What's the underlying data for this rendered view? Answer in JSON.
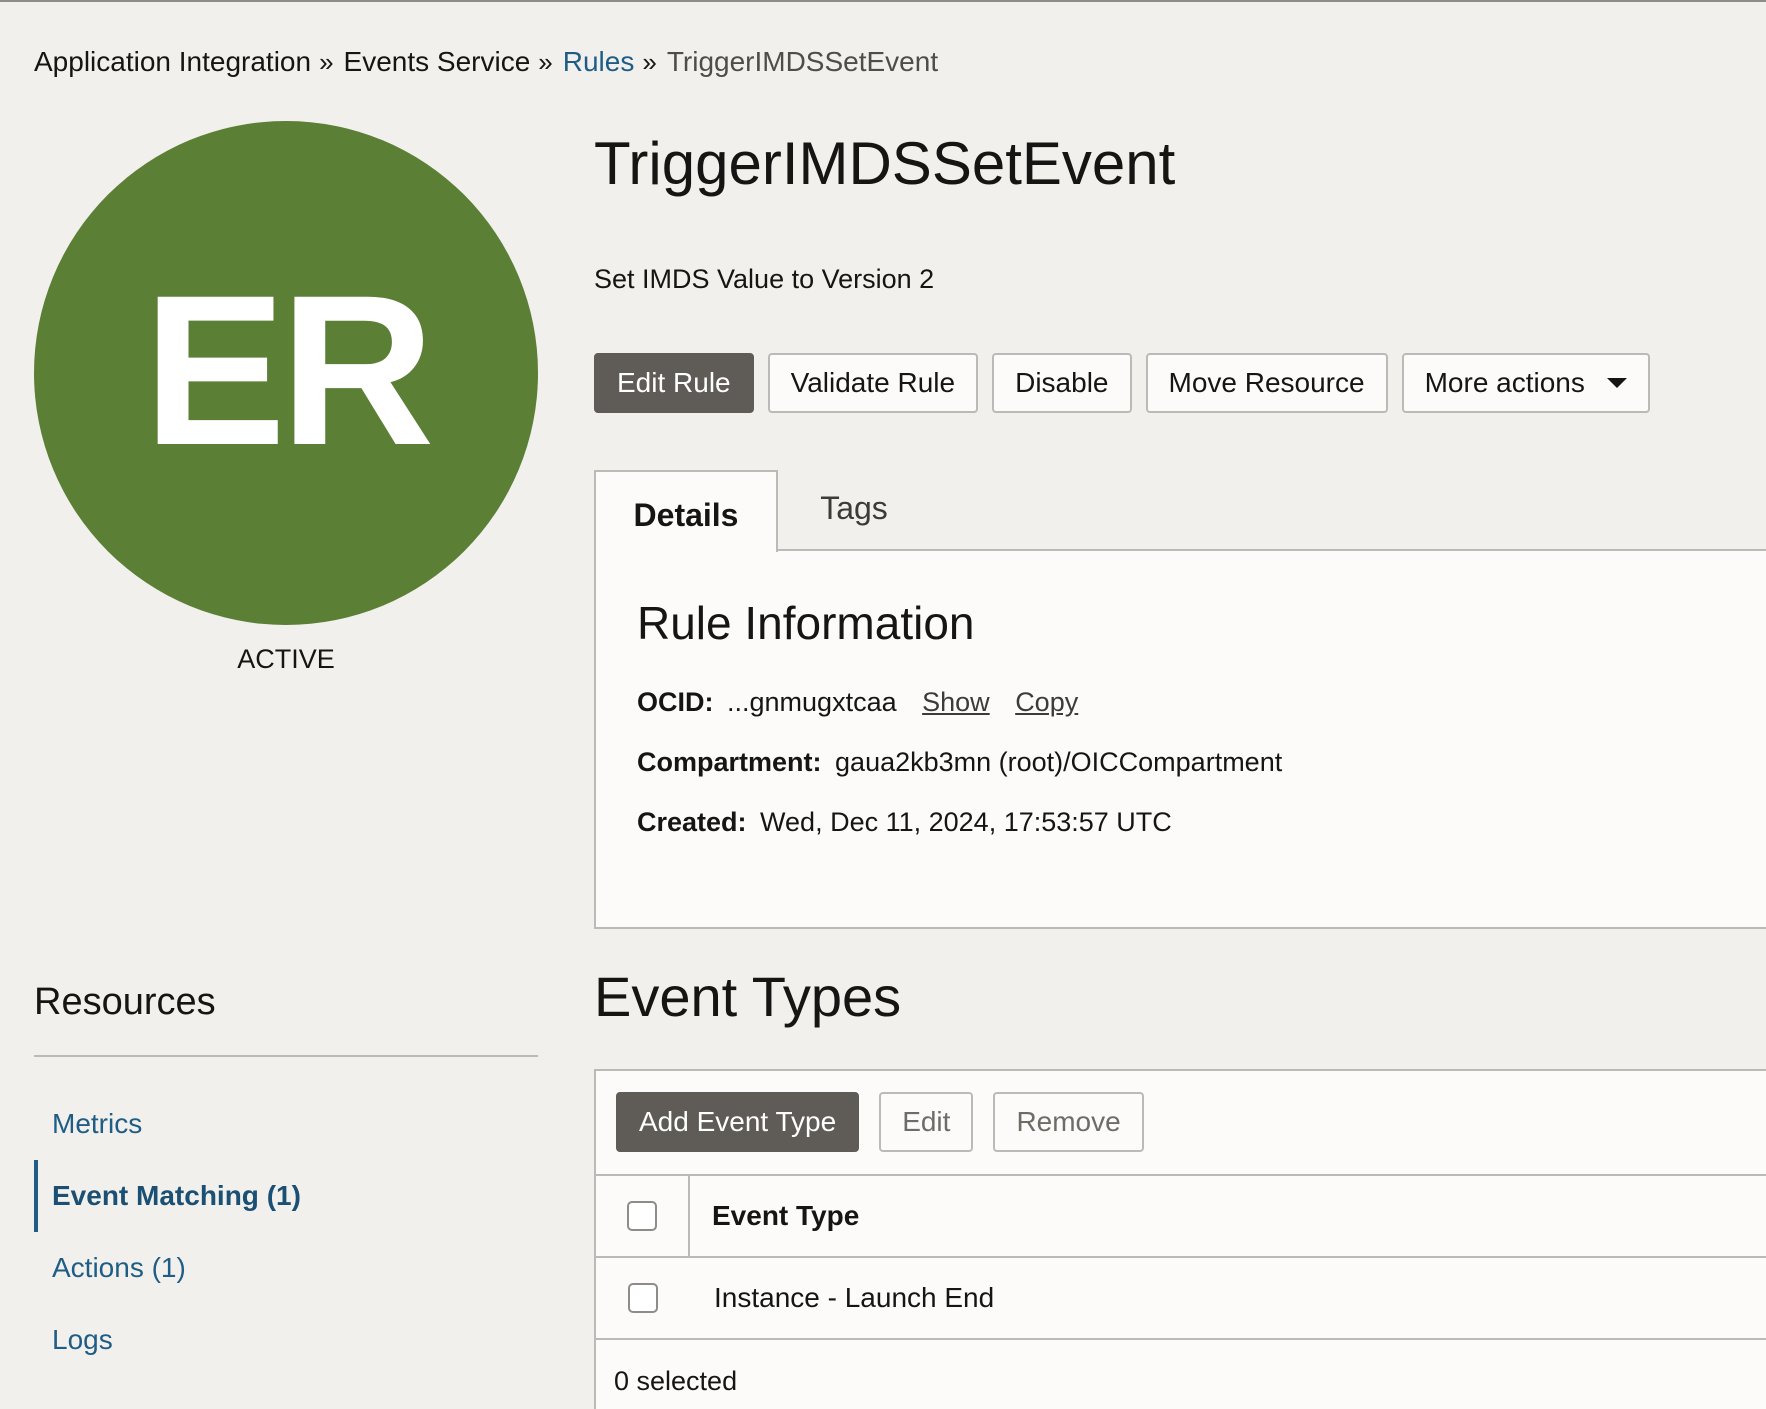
{
  "breadcrumb": [
    {
      "label": "Application Integration",
      "kind": "plain"
    },
    {
      "label": "Events Service",
      "kind": "plain"
    },
    {
      "label": "Rules",
      "kind": "link"
    },
    {
      "label": "TriggerIMDSSetEvent",
      "kind": "current"
    }
  ],
  "breadcrumb_separator": "»",
  "avatar": {
    "initials": "ER",
    "color": "#5a7f35"
  },
  "status": "ACTIVE",
  "rule": {
    "title": "TriggerIMDSSetEvent",
    "description": "Set IMDS Value to Version 2"
  },
  "actions": {
    "edit_rule": "Edit Rule",
    "validate_rule": "Validate Rule",
    "disable": "Disable",
    "move_resource": "Move Resource",
    "more_actions": "More actions"
  },
  "tabs": {
    "details": "Details",
    "tags": "Tags"
  },
  "rule_info": {
    "title": "Rule Information",
    "ocid_label": "OCID:",
    "ocid_value": "...gnmugxtcaa",
    "show_link": "Show",
    "copy_link": "Copy",
    "compartment_label": "Compartment:",
    "compartment_value": "gaua2kb3mn (root)/OICCompartment",
    "created_label": "Created:",
    "created_value": "Wed, Dec 11, 2024, 17:53:57 UTC"
  },
  "resources": {
    "title": "Resources",
    "items": [
      {
        "label": "Metrics",
        "active": false
      },
      {
        "label": "Event Matching (1)",
        "active": true
      },
      {
        "label": "Actions (1)",
        "active": false
      },
      {
        "label": "Logs",
        "active": false
      }
    ]
  },
  "event_types": {
    "title": "Event Types",
    "add_button": "Add Event Type",
    "edit_button": "Edit",
    "remove_button": "Remove",
    "column_header": "Event Type",
    "rows": [
      "Instance - Launch End"
    ],
    "selected_count": "0 selected"
  },
  "colors": {
    "primary_button": "#5f5b56",
    "link": "#1f5d86",
    "background": "#f1f0ec",
    "panel": "#fcfbf9",
    "border": "#bcbab6"
  }
}
